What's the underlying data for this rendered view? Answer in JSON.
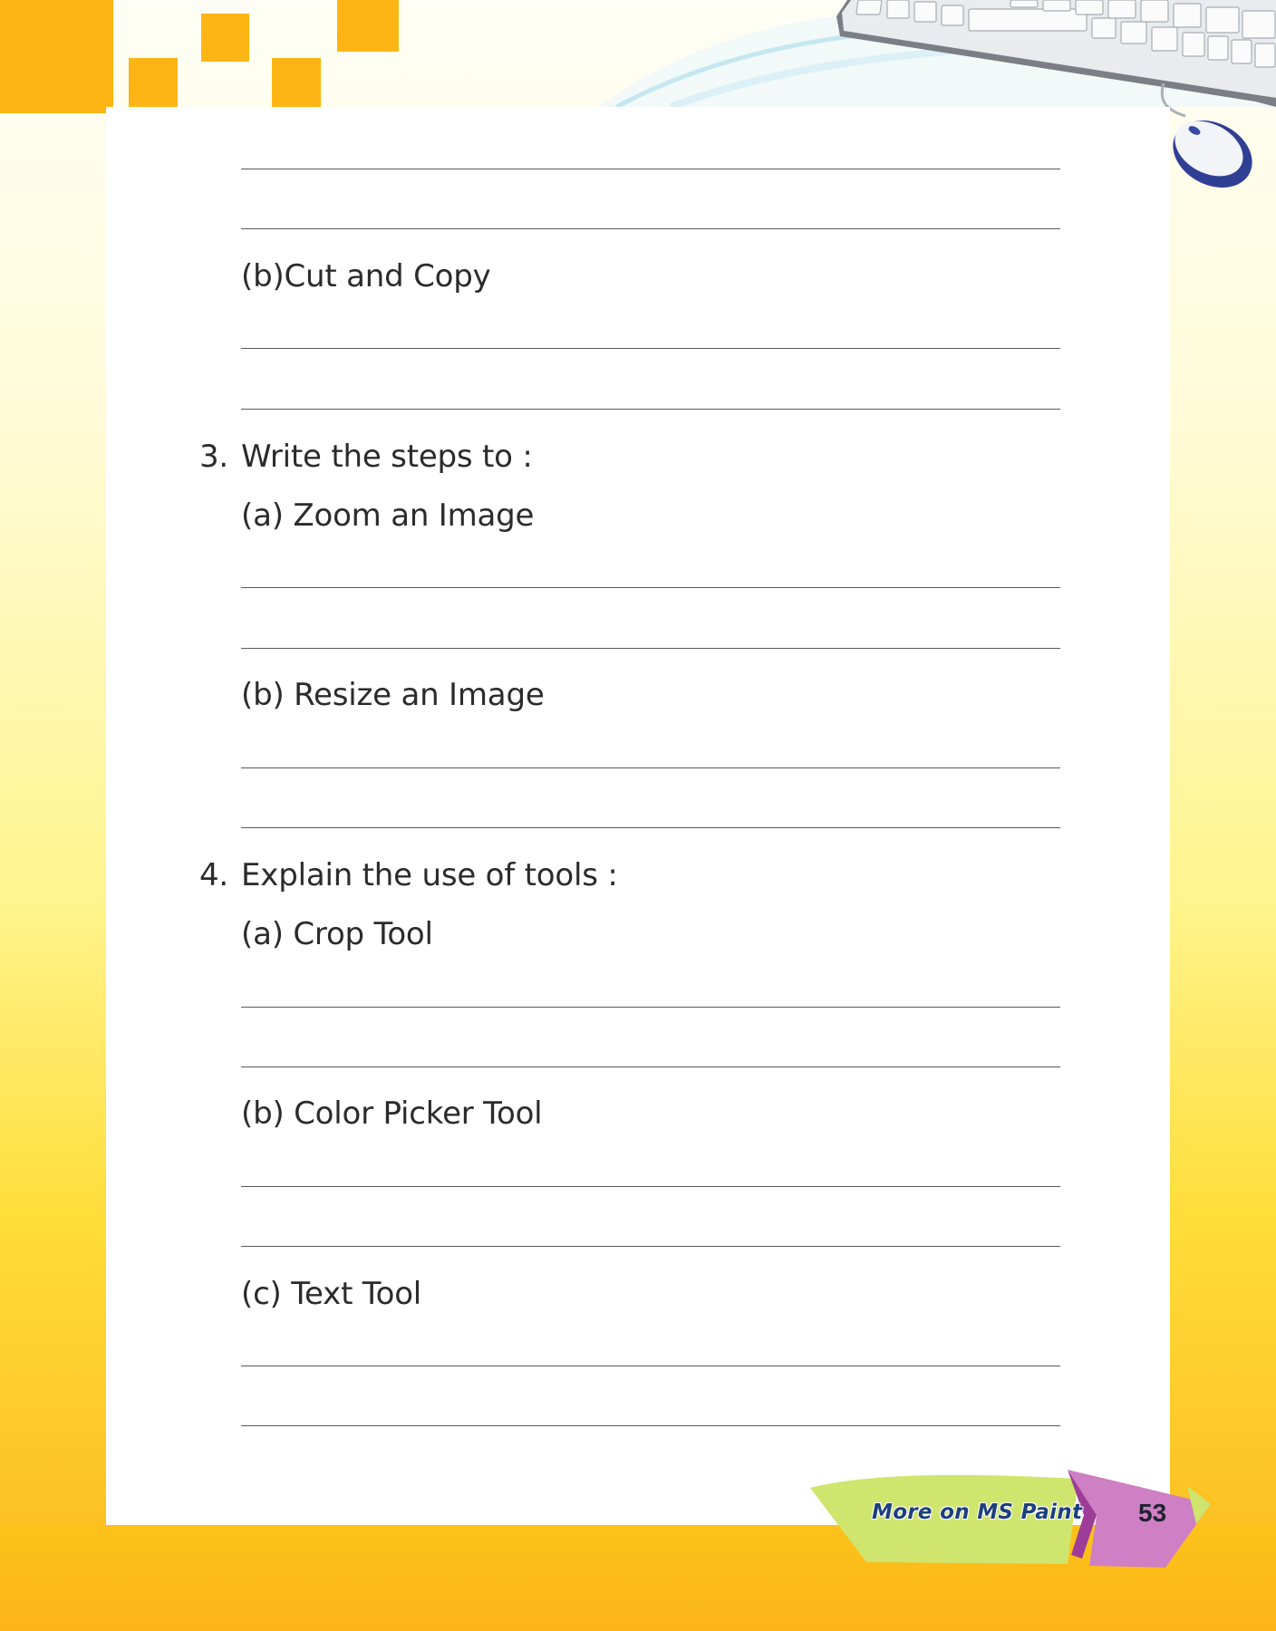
{
  "worksheet": {
    "q2b_label": "(b)Cut and Copy",
    "q3": {
      "number": "3.",
      "prompt": "Write the steps to :",
      "a": "(a) Zoom an Image",
      "b": "(b) Resize an Image"
    },
    "q4": {
      "number": "4.",
      "prompt": "Explain the use of tools :",
      "a": "(a) Crop Tool",
      "b": "(b) Color Picker Tool",
      "c": "(c) Text Tool"
    }
  },
  "footer": {
    "chapter_title": "More on MS Paint",
    "page_number": "53"
  },
  "colors": {
    "accent_orange": "#fcb514",
    "footer_green": "#cfe56d",
    "footer_pink": "#cf7fc3",
    "footer_text_blue": "#1d3f7c"
  },
  "icons": [
    "keyboard-image",
    "mouse-image",
    "decorative-squares"
  ]
}
